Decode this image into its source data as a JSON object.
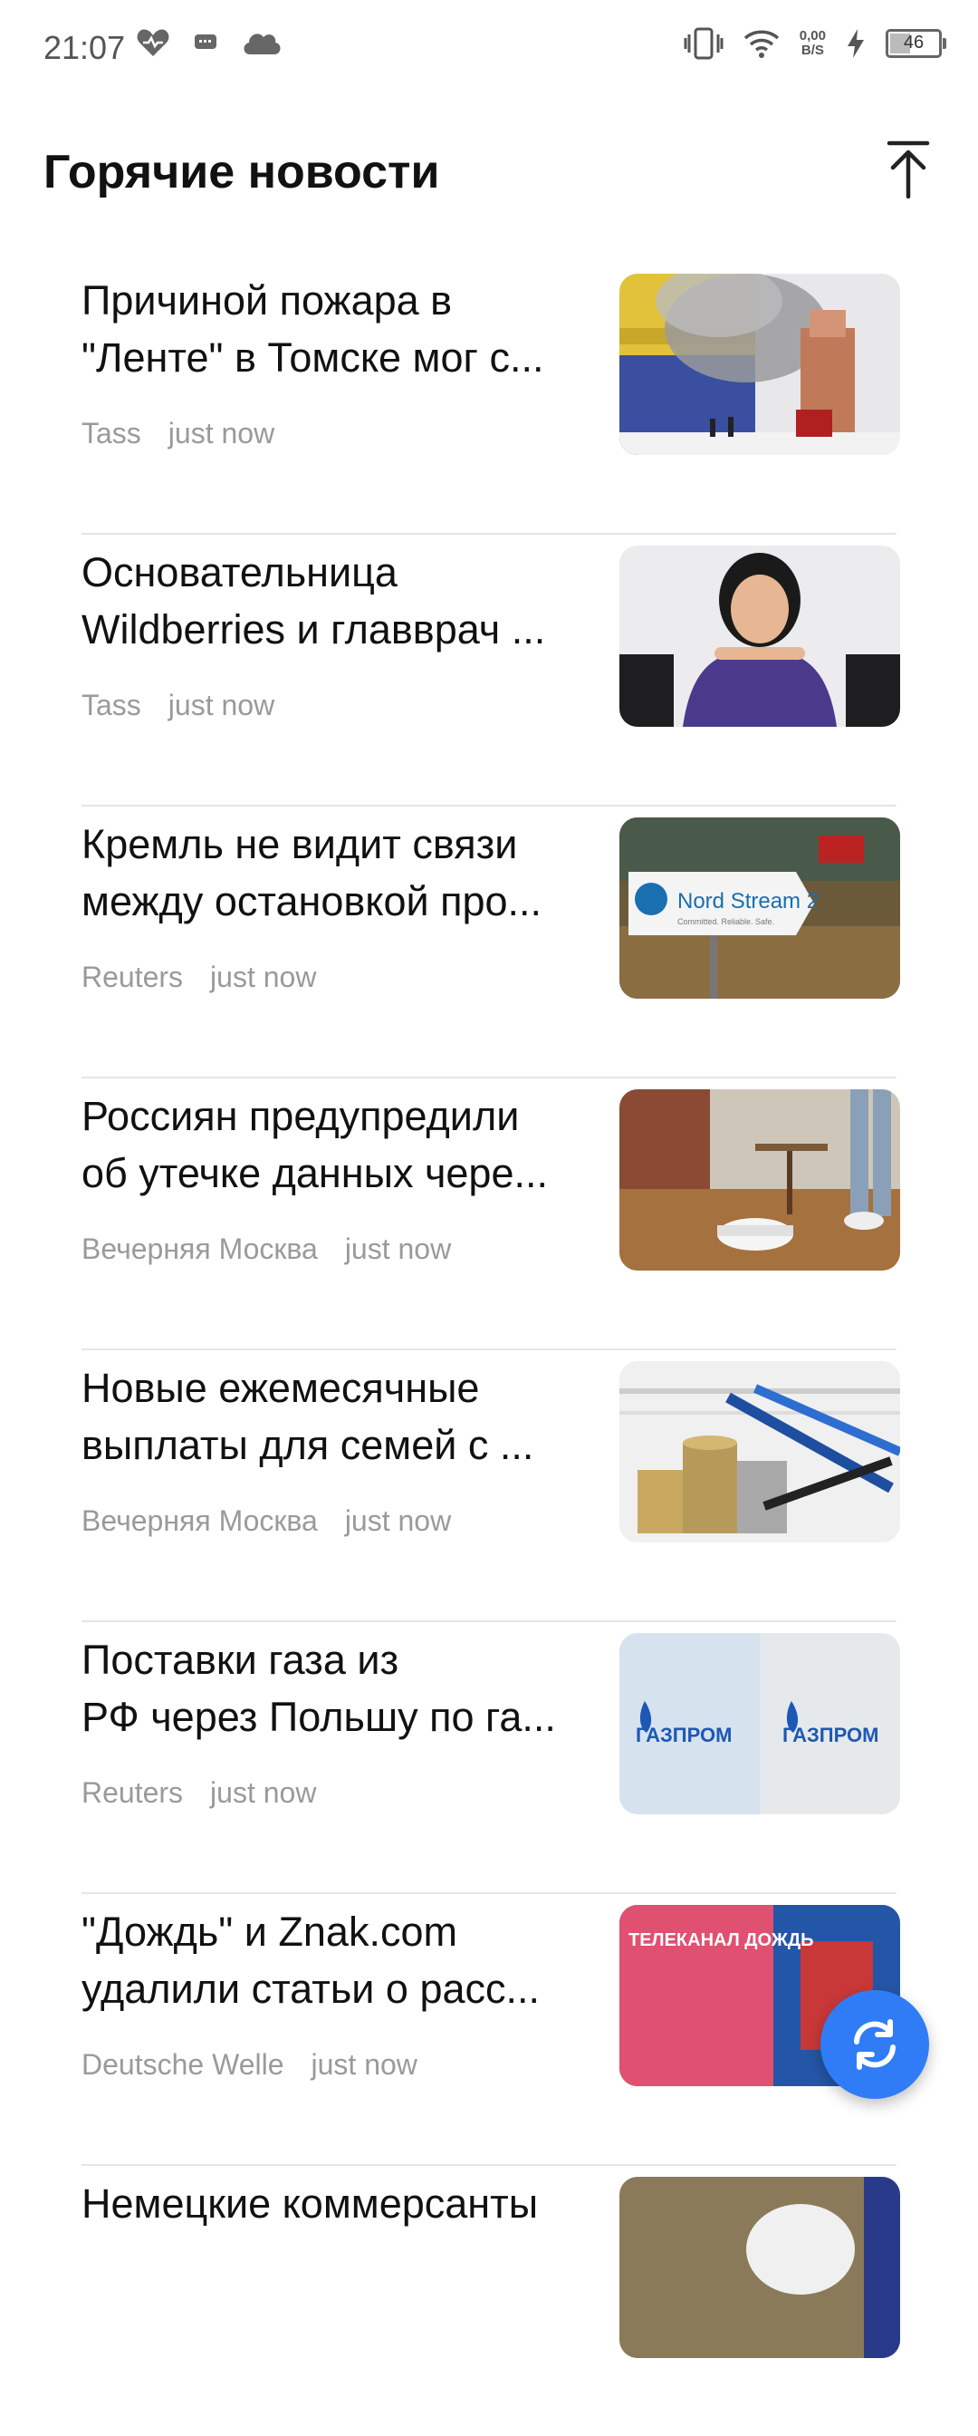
{
  "status_bar": {
    "time": "21:07",
    "speed_value": "0,00",
    "speed_unit": "B/S",
    "battery": "46",
    "battery_level": 0.46,
    "icons": [
      "heart-icon",
      "message-icon",
      "cloud-icon",
      "vibrate-icon",
      "wifi-icon",
      "charging-icon",
      "battery-icon"
    ]
  },
  "header": {
    "title": "Горячие новости",
    "scroll_top_icon": "arrow-up-to-top-icon"
  },
  "news": [
    {
      "line1": "Причиной пожара в",
      "line2": "\"Ленте\" в Томске мог с...",
      "source": "Tass",
      "time": "just now",
      "image": "store-fire-photo"
    },
    {
      "line1": "Основательница",
      "line2": "Wildberries и главврач ...",
      "source": "Tass",
      "time": "just now",
      "image": "woman-portrait-photo"
    },
    {
      "line1": "Кремль не видит связи",
      "line2": "между остановкой про...",
      "source": "Reuters",
      "time": "just now",
      "image": "nord-stream-sign-photo",
      "image_text": "Nord Stream 2",
      "image_subtext": "Committed. Reliable. Safe."
    },
    {
      "line1": "Россиян предупредили",
      "line2": "об утечке данных чере...",
      "source": "Вечерняя Москва",
      "time": "just now",
      "image": "robot-vacuum-photo"
    },
    {
      "line1": "Новые ежемесячные",
      "line2": "выплаты для семей с ...",
      "source": "Вечерняя Москва",
      "time": "just now",
      "image": "coins-pens-photo"
    },
    {
      "line1": "Поставки газа из",
      "line2": "РФ через Польшу по га...",
      "source": "Reuters",
      "time": "just now",
      "image": "gazprom-logo-photo",
      "image_text": "ГАЗПРОМ"
    },
    {
      "line1": "\"Дождь\" и Znak.com",
      "line2": "удалили статьи о расс...",
      "source": "Deutsche Welle",
      "time": "just now",
      "image": "dozhd-sign-photo",
      "image_text": "ТЕЛЕКАНАЛ ДОЖДЬ"
    },
    {
      "line1": "Немецкие коммерсанты",
      "line2": "",
      "source": "",
      "time": "",
      "image": "hands-photo"
    }
  ],
  "fab": {
    "icon": "refresh-icon",
    "color": "#2f7cf6"
  }
}
